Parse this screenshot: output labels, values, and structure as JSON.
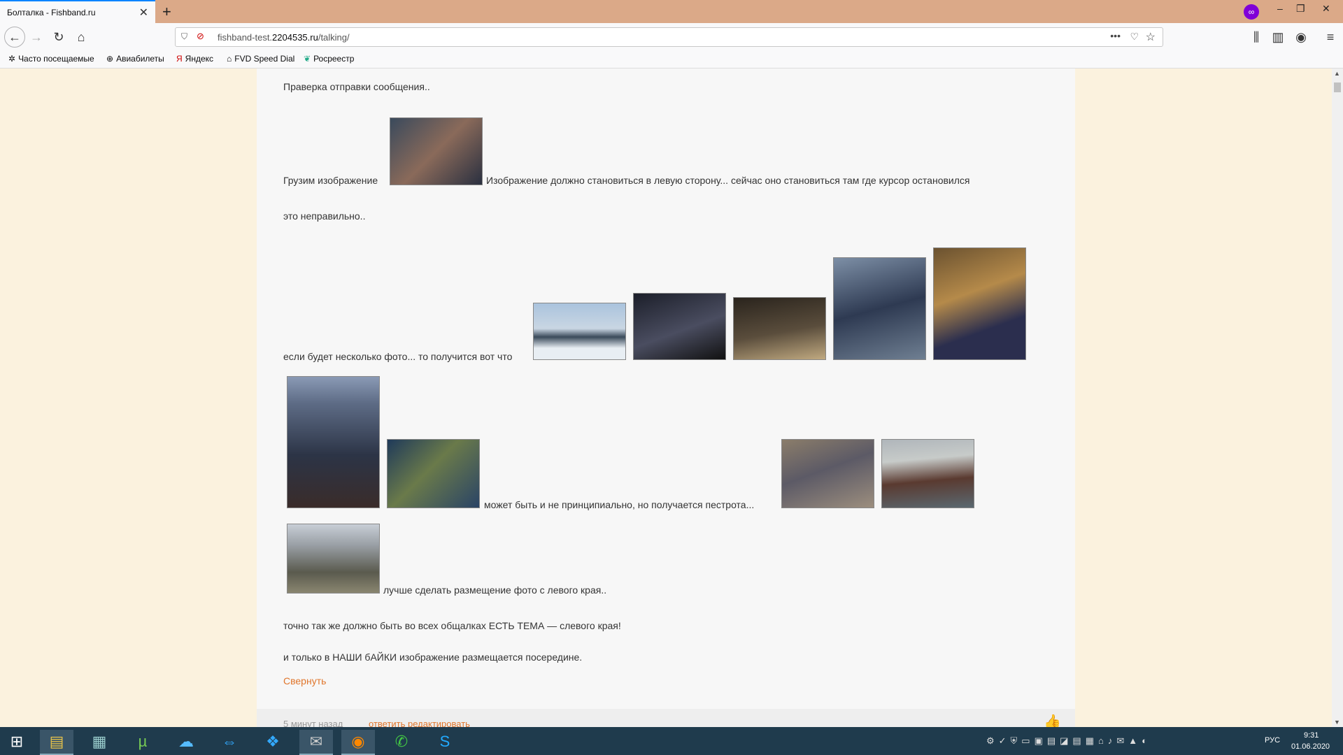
{
  "browser": {
    "tab_title": "Болталка - Fishband.ru",
    "url_prefix": "fishband-test.",
    "url_host": "2204535.ru",
    "url_path": "/talking/"
  },
  "bookmarks": [
    {
      "label": "Часто посещаемые",
      "icon": "gear-icon"
    },
    {
      "label": "Авиабилеты",
      "icon": "globe-icon"
    },
    {
      "label": "Яндекс",
      "icon": "yandex-icon"
    },
    {
      "label": "FVD Speed Dial",
      "icon": "speed-dial-icon"
    },
    {
      "label": "Росреестр",
      "icon": "rosreestr-icon"
    }
  ],
  "post": {
    "line1": "Праверка отправки сообщения..",
    "line2_before": "Грузим изображение",
    "line2_after": "Изображение должно становиться в левую сторону... сейчас оно становиться там где курсор остановился",
    "line3": "это неправильно..",
    "line4": "если будет несколько фото... то получится вот что",
    "line5": "может быть и не принципиально, но получается пестрота...",
    "line6": "лучше сделать размещение фото с левого края..",
    "line7": "точно так же должно быть во всех общалках ЕСТЬ ТЕМА — слевого края!",
    "line8": "и только в НАШИ бАЙКИ изображение размещается посередине.",
    "collapse": "Свернуть"
  },
  "footer": {
    "text": "5 минут назад",
    "links": "ответить  редактировать"
  },
  "taskbar": {
    "lang": "РУС",
    "time": "9:31",
    "date": "01.06.2020"
  }
}
